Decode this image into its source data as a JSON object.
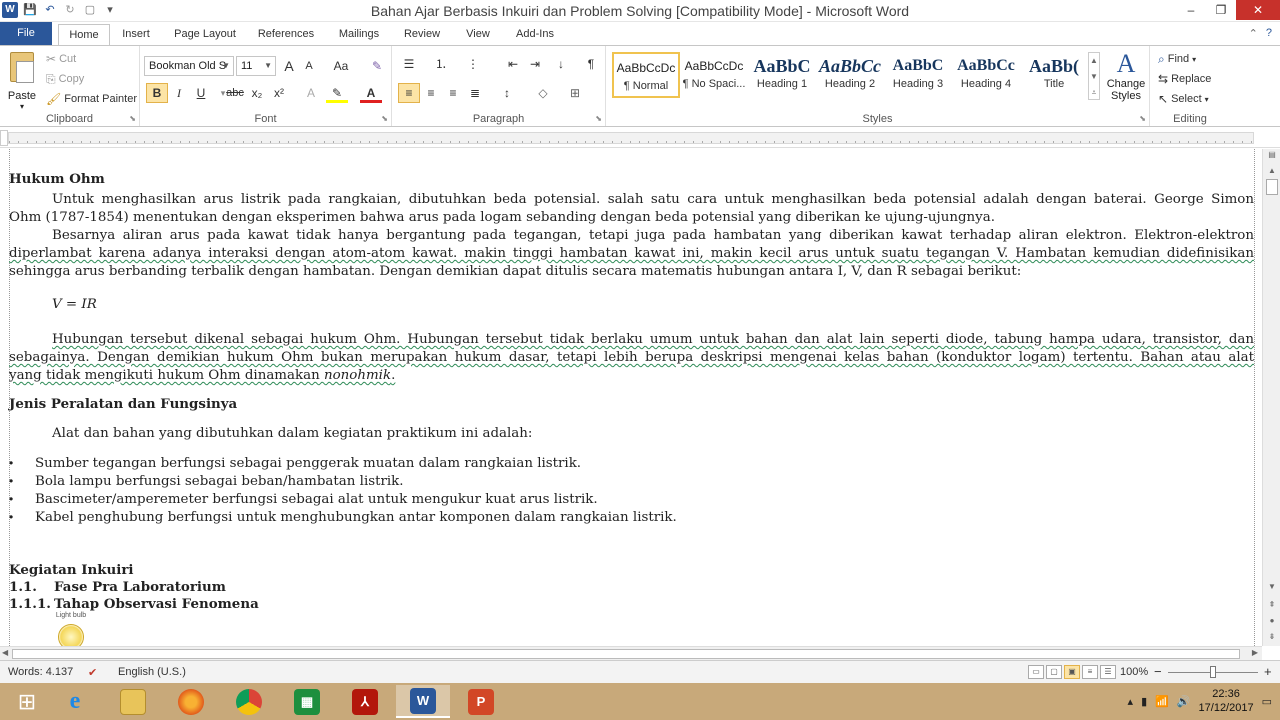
{
  "window": {
    "title": "Bahan Ajar Berbasis Inkuiri dan Problem Solving [Compatibility Mode]  -  Microsoft Word",
    "controls": [
      "?",
      "–",
      "❐",
      "✕"
    ]
  },
  "tabs": {
    "file": "File",
    "items": [
      "Home",
      "Insert",
      "Page Layout",
      "References",
      "Mailings",
      "Review",
      "View",
      "Add-Ins"
    ]
  },
  "ribbon": {
    "clipboard": {
      "label": "Clipboard",
      "paste": "Paste",
      "cut": "Cut",
      "copy": "Copy",
      "format_painter": "Format Painter"
    },
    "font": {
      "label": "Font",
      "font_name": "Bookman Old S",
      "font_size": "11",
      "bold": "B",
      "italic": "I",
      "underline": "U",
      "strike": "abc",
      "subscript": "x₂",
      "superscript": "x²",
      "grow": "A",
      "shrink": "A",
      "change_case": "Aa",
      "clear": "A"
    },
    "paragraph": {
      "label": "Paragraph",
      "pilcrow": "¶"
    },
    "styles": {
      "label": "Styles",
      "items": [
        {
          "preview": "AaBbCcDc",
          "name": "¶ Normal"
        },
        {
          "preview": "AaBbCcDc",
          "name": "¶ No Spaci..."
        },
        {
          "preview": "AaBbC",
          "name": "Heading 1"
        },
        {
          "preview": "AaBbCc",
          "name": "Heading 2"
        },
        {
          "preview": "AaBbC",
          "name": "Heading 3"
        },
        {
          "preview": "AaBbCc",
          "name": "Heading 4"
        },
        {
          "preview": "AaBb(",
          "name": "Title"
        }
      ],
      "change_styles": "Change Styles",
      "change_styles_a": "A"
    },
    "editing": {
      "label": "Editing",
      "find": "Find",
      "replace": "Replace",
      "select": "Select"
    }
  },
  "document": {
    "h1": "Hukum Ohm",
    "p1a": "Untuk menghasilkan arus listrik pada rangkaian, dibutuhkan beda potensial. salah satu cara untuk menghasilkan beda potensial adalah dengan baterai. George Simon",
    "p1b": "Ohm (1787-1854) menentukan dengan eksperimen bahwa arus pada logam sebanding dengan beda potensial yang diberikan ke ujung-ujungnya.",
    "p2a": "Besarnya aliran arus pada kawat tidak hanya bergantung pada tegangan, tetapi juga pada hambatan yang diberikan kawat terhadap aliran elektron. Elektron-elektron",
    "p2b": "diperlambat karena adanya interaksi dengan atom-atom kawat. makin tinggi hambatan kawat ini, makin kecil arus untuk suatu tegangan V. Hambatan kemudian didefinisikan",
    "p2c": "sehingga arus berbanding terbalik dengan hambatan. Dengan demikian dapat ditulis secara matematis hubungan antara I, V, dan R sebagai berikut:",
    "formula": "V = IR",
    "p3a": "Hubungan tersebut dikenal sebagai hukum Ohm. Hubungan tersebut tidak berlaku umum untuk bahan dan alat lain seperti diode, tabung hampa udara, transistor, dan",
    "p3b": "sebagainya. Dengan demikian hukum Ohm bukan merupakan hukum dasar, tetapi lebih berupa deskripsi mengenai kelas bahan (konduktor logam) tertentu. Bahan atau alat",
    "p3c_a": "yang tidak mengikuti hukum Ohm dinamakan ",
    "p3c_b": "nonohmik",
    "p3c_c": ".",
    "h2": "Jenis Peralatan dan Fungsinya",
    "p4": "Alat dan bahan yang dibutuhkan dalam kegiatan praktikum ini adalah:",
    "bullets": [
      "Sumber tegangan berfungsi sebagai penggerak muatan dalam rangkaian listrik.",
      "Bola lampu berfungsi sebagai beban/hambatan listrik.",
      "Bascimeter/amperemeter berfungsi sebagai alat untuk mengukur kuat arus listrik.",
      "Kabel penghubung berfungsi untuk menghubungkan antar komponen dalam rangkaian listrik."
    ],
    "h3": "Kegiatan Inkuiri",
    "h4_num": "1.1.",
    "h4": "Fase Pra Laboratorium",
    "h5_num": "1.1.1.",
    "h5": "Tahap Observasi Fenomena",
    "image_label": "Light bulb"
  },
  "status": {
    "words": "Words: 4.137",
    "language": "English (U.S.)",
    "zoom": "100%",
    "zoom_minus": "−",
    "zoom_plus": "+"
  },
  "taskbar": {
    "time": "22:36",
    "date": "17/12/2017"
  }
}
